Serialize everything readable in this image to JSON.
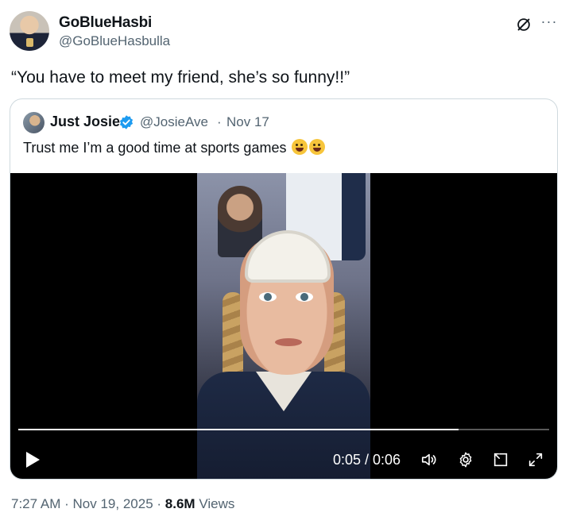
{
  "author": {
    "name": "GoBlueHasbi",
    "handle": "@GoBlueHasbulla"
  },
  "tweet": {
    "text": "“You have to meet my friend, she’s so funny!!”"
  },
  "quoted": {
    "name": "Just Josie",
    "handle": "@JosieAve",
    "separator": "·",
    "date": "Nov 17",
    "text": "Trust me I’m a good time at sports games"
  },
  "video": {
    "time": "0:05 / 0:06",
    "progress": 0.83
  },
  "footer": {
    "time": "7:27 AM",
    "sep1": "·",
    "date": "Nov 19, 2025",
    "sep2": "·",
    "views_count": "8.6M",
    "views_label": "Views"
  },
  "icons": [
    "grok-icon",
    "more-icon",
    "verified-icon",
    "play-icon",
    "volume-icon",
    "settings-icon",
    "pip-icon",
    "fullscreen-icon"
  ],
  "colors": {
    "verified": "#1d9bf0",
    "secondary_text": "#536471",
    "text": "#0f1419",
    "border": "#cfd9de"
  }
}
